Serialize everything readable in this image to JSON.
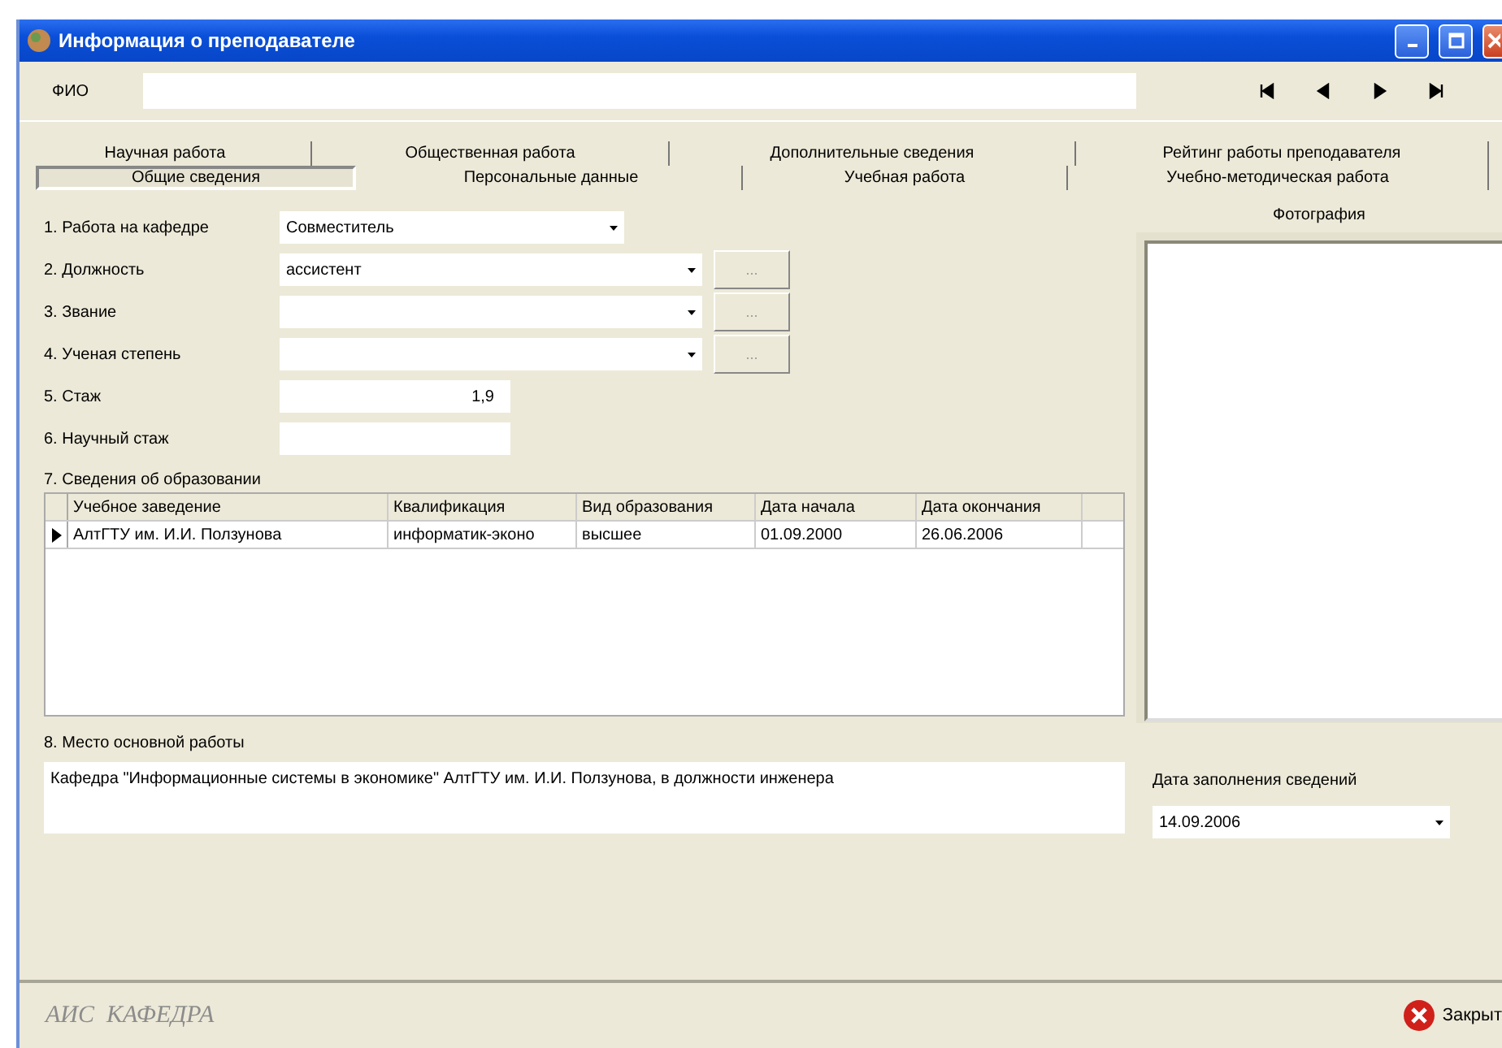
{
  "window": {
    "title": "Информация о преподавателе"
  },
  "fio": {
    "label": "ФИО"
  },
  "tab_rows": [
    {
      "tabs": [
        {
          "label": "Научная работа",
          "selected": false
        },
        {
          "label": "Общественная работа",
          "selected": false
        },
        {
          "label": "Дополнительные сведения",
          "selected": false
        },
        {
          "label": "Рейтинг работы преподавателя",
          "selected": false
        }
      ]
    },
    {
      "tabs": [
        {
          "label": "Общие сведения",
          "selected": true
        },
        {
          "label": "Персональные данные",
          "selected": false
        },
        {
          "label": "Учебная работа",
          "selected": false
        },
        {
          "label": "Учебно-методическая работа",
          "selected": false
        }
      ]
    }
  ],
  "fields": [
    {
      "label": "1. Работа на кафедре",
      "kind": "combo",
      "value": "Совместитель"
    },
    {
      "label": "2. Должность",
      "kind": "combo",
      "value": "ассистент",
      "button": "..."
    },
    {
      "label": "3. Звание",
      "kind": "combo",
      "button": "..."
    },
    {
      "label": "4. Ученая степень",
      "kind": "combo",
      "button": "..."
    },
    {
      "label": "5. Стаж",
      "kind": "number",
      "value": "1,9"
    },
    {
      "label": "6. Научный стаж",
      "kind": "number"
    }
  ],
  "education": {
    "label": "7. Сведения об образовании",
    "columns": [
      "Учебное заведение",
      "Квалификация",
      "Вид образования",
      "Дата начала",
      "Дата окончания"
    ],
    "rows": [
      {
        "selected": true,
        "cells": [
          "АлтГТУ им. И.И. Ползунова",
          "информатик-эконо",
          "высшее",
          "01.09.2000",
          "26.06.2006"
        ]
      }
    ]
  },
  "workplace": {
    "label": "8. Место основной работы",
    "value": "Кафедра \"Информационные системы в экономике\" АлтГТУ им. И.И. Ползунова, в должности инженера"
  },
  "photo": {
    "label": "Фотография"
  },
  "fill_date": {
    "label": "Дата заполнения сведений",
    "value": "14.09.2006"
  },
  "footer": {
    "brand": "АИС  КАФЕДРА",
    "close_button": "Закрыт"
  }
}
